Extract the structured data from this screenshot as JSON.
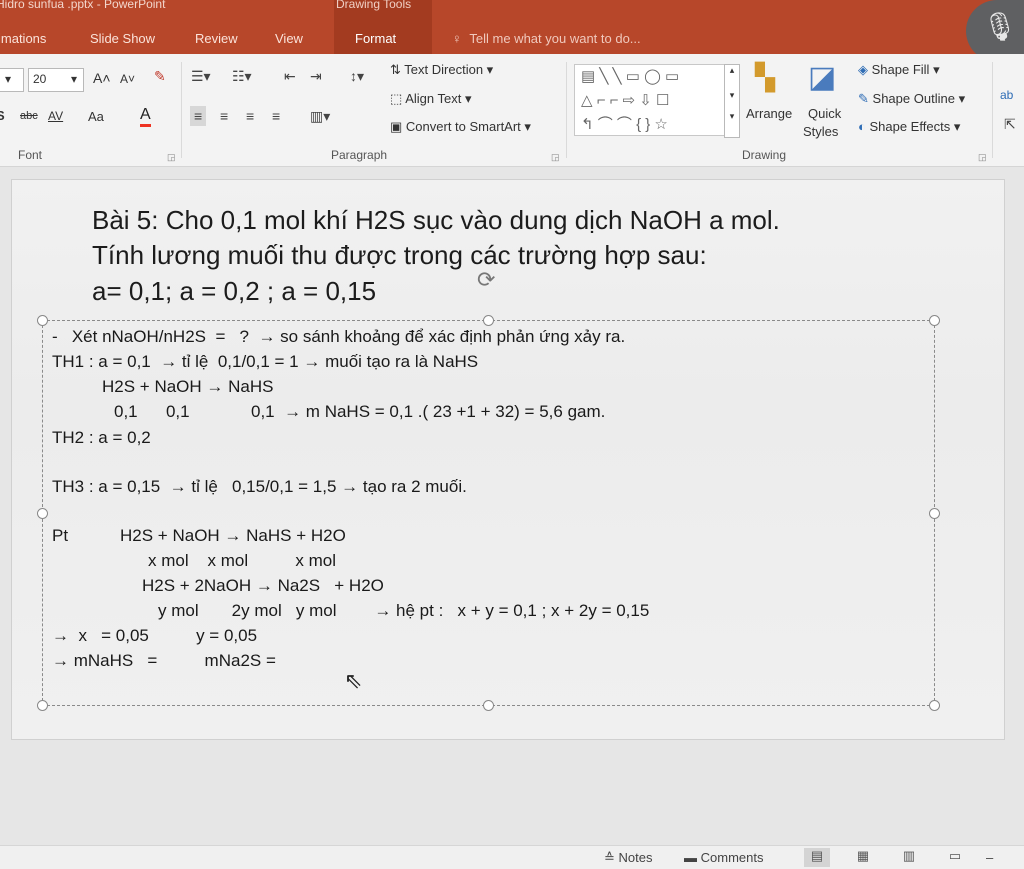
{
  "window": {
    "title": "Hidro sunfua .pptx - PowerPoint"
  },
  "context_tab_group": "Drawing Tools",
  "tabs": [
    {
      "label": "imations"
    },
    {
      "label": "Slide Show"
    },
    {
      "label": "Review"
    },
    {
      "label": "View"
    },
    {
      "label": "Format"
    }
  ],
  "tell_me": {
    "placeholder": "Tell me what you want to do..."
  },
  "ribbon": {
    "font": {
      "group_label": "Font",
      "size": "20",
      "grow": "A˄",
      "shrink": "A˅",
      "strike": "abc",
      "spacing": "AV",
      "case": "Aa",
      "color_letter": "A"
    },
    "paragraph": {
      "group_label": "Paragraph",
      "text_direction": "Text Direction",
      "align_text": "Align Text",
      "convert_smartart": "Convert to SmartArt"
    },
    "drawing": {
      "group_label": "Drawing",
      "arrange": "Arrange",
      "quick_styles_1": "Quick",
      "quick_styles_2": "Styles",
      "shape_fill": "Shape Fill",
      "shape_outline": "Shape Outline",
      "shape_effects": "Shape Effects"
    }
  },
  "slide": {
    "title_lines": [
      "Bài 5: Cho 0,1 mol khí H2S sục vào dung dịch NaOH a mol.",
      "Tính lương muối thu được trong các trường hợp sau:",
      " a= 0,1;  a = 0,2 ; a = 0,15"
    ],
    "body_lines": [
      "-   Xét nNaOH/nH2S  =   ?  → so sánh khoảng để xác định phản ứng xảy ra.",
      "TH1 : a = 0,1  → tỉ lệ  0,1/0,1 = 1 → muối tạo ra là NaHS",
      "H2S + NaOH → NaHS",
      "0,1      0,1             0,1  → m NaHS = 0,1 .( 23 +1 + 32) = 5,6 gam.",
      "TH2 : a = 0,2",
      "TH3 : a = 0,15  → tỉ lệ   0,15/0,1 = 1,5 → tạo ra 2 muối.",
      "Pt           H2S + NaOH → NaHS + H2O",
      "x mol    x mol          x mol",
      "H2S + 2NaOH → Na2S   + H2O",
      "y mol       2y mol   y mol        → hệ pt :   x + y = 0,1 ; x + 2y = 0,15",
      "→  x   = 0,05          y = 0,05",
      "→ mNaHS   =          mNa2S ="
    ]
  },
  "status": {
    "notes": "Notes",
    "comments": "Comments"
  }
}
